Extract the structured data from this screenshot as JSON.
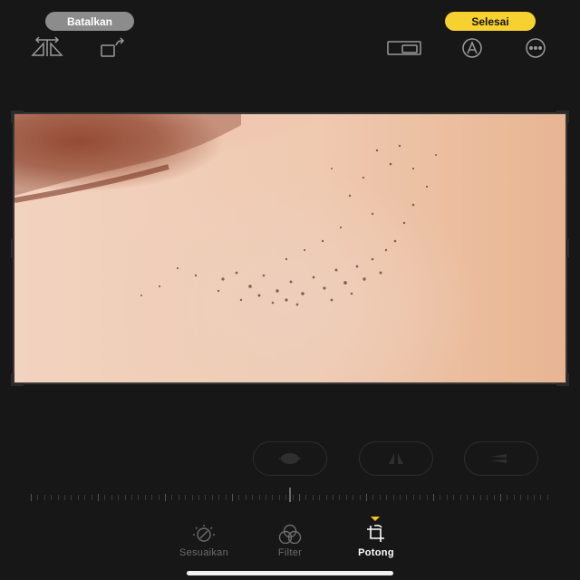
{
  "header": {
    "cancel_label": "Batalkan",
    "done_label": "Selesai",
    "left_icons": [
      "flip-horizontal-icon",
      "rotate-icon"
    ],
    "right_icons": [
      "aspect-ratio-icon",
      "markup-pen-icon",
      "more-options-icon"
    ]
  },
  "photo": {
    "subject": "close-up of cheek skin with pores"
  },
  "tools": [
    {
      "name": "straighten-icon"
    },
    {
      "name": "vertical-perspective-icon"
    },
    {
      "name": "horizontal-perspective-icon"
    }
  ],
  "bottom_tabs": [
    {
      "label": "Sesuaikan",
      "icon": "adjust-dial-icon",
      "active": false
    },
    {
      "label": "Filter",
      "icon": "filter-circles-icon",
      "active": false
    },
    {
      "label": "Potong",
      "icon": "crop-rotate-icon",
      "active": true
    }
  ],
  "colors": {
    "background": "#171717",
    "accent": "#f7d130",
    "cancel_pill": "#8c8c8c"
  }
}
